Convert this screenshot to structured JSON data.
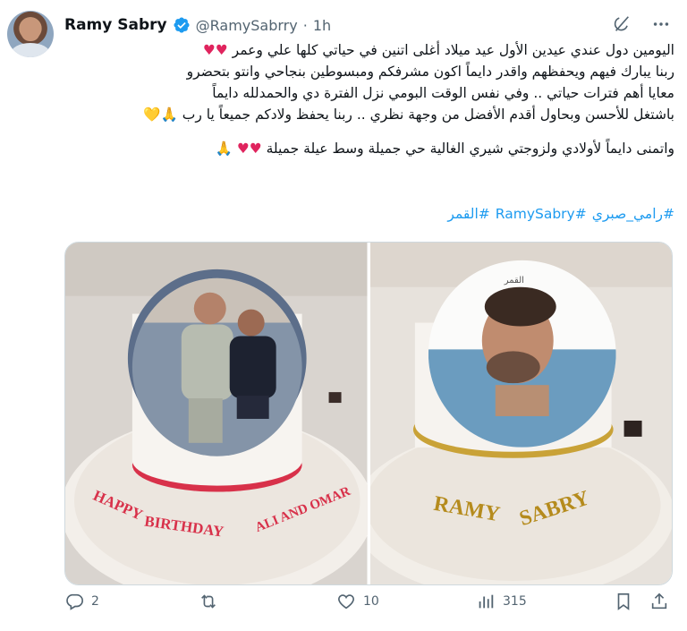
{
  "tweet": {
    "author_name": "Ramy Sabry",
    "handle": "@RamySabrry",
    "separator": "·",
    "time": "1h",
    "lines": [
      "اليومين دول عندي عيدين الأول عيد ميلاد أغلى اتنين في حياتي كلها علي وعمر",
      "ربنا يبارك فيهم ويحفظهم واقدر دايماً اكون مشرفكم ومبسوطين بنجاحي وانتو بتحضرو",
      "معايا أهم فترات حياتي .. وفي نفس الوقت البومي نزل الفترة دي والحمدلله دايماً",
      "باشتغل للأحسن وبحاول أقدم الأفضل من وجهة نظري .. ربنا يحفظ ولادكم جميعاً يا رب",
      "واتمنى دايماً لأولادي ولزوجتي شيري الغالية حي جميلة وسط عيلة جميلة"
    ],
    "hashtags": [
      "#رامي_صبري",
      "#RamySabry",
      "#القمر"
    ]
  },
  "media": {
    "left_cake_text": "HAPPY BIRTHDAY ALI AND OMAR",
    "right_cake_text": "RAMY SABRY",
    "right_cake_topper": "القمر"
  },
  "actions": {
    "replies": "2",
    "retweets": "",
    "likes": "10",
    "views": "315"
  },
  "icons": {
    "verified": "verified-badge-icon",
    "grok": "grok-icon",
    "more": "more-icon",
    "reply": "reply-icon",
    "retweet": "retweet-icon",
    "like": "heart-icon",
    "views": "views-icon",
    "bookmark": "bookmark-icon",
    "share": "share-icon"
  },
  "colors": {
    "accent": "#1d9bf0",
    "heart": "#e0245e",
    "muted": "#536471"
  }
}
